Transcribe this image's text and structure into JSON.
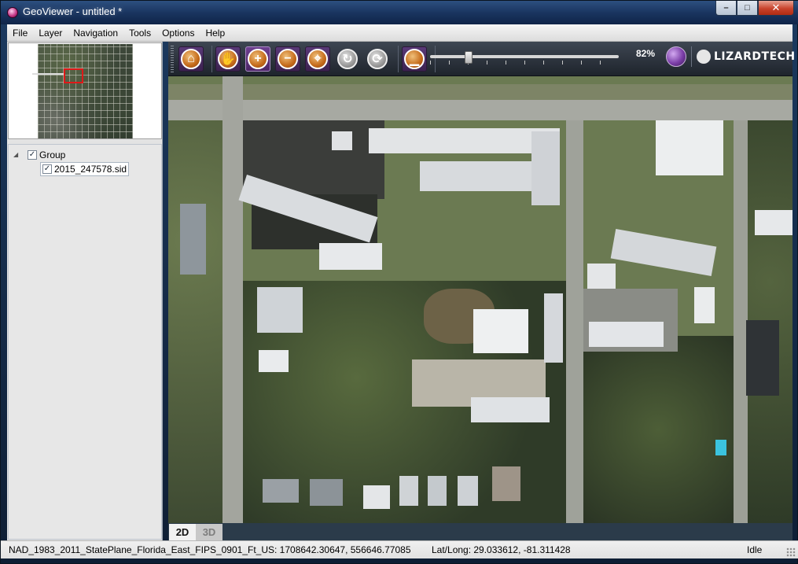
{
  "window": {
    "title": "GeoViewer - untitled *",
    "minimize_label": "–",
    "maximize_label": "□",
    "close_label": "✕"
  },
  "menu": {
    "items": [
      "File",
      "Layer",
      "Navigation",
      "Tools",
      "Options",
      "Help"
    ]
  },
  "layers": {
    "group_label": "Group",
    "group_checked": true,
    "items": [
      {
        "label": "2015_247578.sid",
        "checked": true
      }
    ]
  },
  "toolbar": {
    "tools": [
      {
        "name": "home-icon",
        "glyph": "⌂"
      },
      {
        "name": "pan-hand-icon",
        "glyph": "✋"
      },
      {
        "name": "zoom-in-icon",
        "glyph": "+"
      },
      {
        "name": "zoom-out-icon",
        "glyph": "−"
      },
      {
        "name": "zoom-to-extent-icon",
        "glyph": "⌖"
      },
      {
        "name": "rotate-icon",
        "glyph": "↻"
      },
      {
        "name": "refresh-icon",
        "glyph": "⟳"
      },
      {
        "name": "measure-icon",
        "glyph": "▁"
      }
    ],
    "active_tool": "zoom-in-icon",
    "zoom_level": 0.82,
    "zoom_text": "82%"
  },
  "brand": {
    "text": "LIZARDTECH"
  },
  "view_tabs": {
    "tab_2d": "2D",
    "tab_3d": "3D",
    "active": "2D"
  },
  "status": {
    "projection": "NAD_1983_2011_StatePlane_Florida_East_FIPS_0901_Ft_US: 1708642.30647, 556646.77085",
    "latlong": "Lat/Long: 29.033612, -81.311428",
    "state": "Idle"
  },
  "colors": {
    "accent": "#5a3978",
    "active_tool_border": "#a98ac4",
    "overview_frame": "#e01818"
  }
}
